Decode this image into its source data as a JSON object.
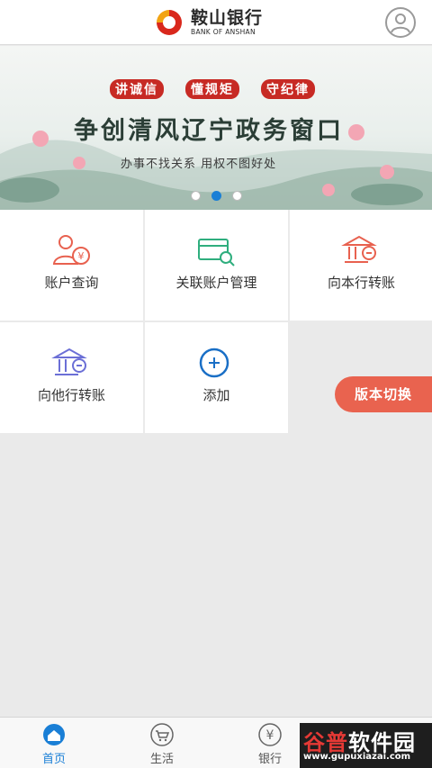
{
  "header": {
    "bank_name_cn": "鞍山银行",
    "bank_name_en": "BANK OF ANSHAN",
    "avatar_icon": "user-avatar-icon"
  },
  "banner": {
    "slogans": [
      "讲诚信",
      "懂规矩",
      "守纪律"
    ],
    "title": "争创清风辽宁政务窗口",
    "subtitle": "办事不找关系 用权不图好处",
    "slides": 3,
    "active_slide": 2
  },
  "menu": [
    {
      "label": "账户查询",
      "icon": "account-query-icon",
      "color": "#e8614f"
    },
    {
      "label": "关联账户管理",
      "icon": "linked-account-icon",
      "color": "#2fae7e"
    },
    {
      "label": "向本行转账",
      "icon": "bank-transfer-icon",
      "color": "#e8614f"
    },
    {
      "label": "向他行转账",
      "icon": "other-bank-transfer-icon",
      "color": "#6b6fd6"
    },
    {
      "label": "添加",
      "icon": "add-circle-icon",
      "color": "#1a6fc6"
    }
  ],
  "switch_button": {
    "label": "版本切换",
    "color": "#e9634f"
  },
  "tabbar": {
    "tabs": [
      {
        "label": "首页",
        "icon": "home-icon"
      },
      {
        "label": "生活",
        "icon": "cart-icon"
      },
      {
        "label": "银行",
        "icon": "yen-icon"
      }
    ],
    "accent": "#1a7fd6"
  },
  "watermark": {
    "name_red": "谷普",
    "name_white": "软件园",
    "url": "www.gupuxiazai.com"
  }
}
